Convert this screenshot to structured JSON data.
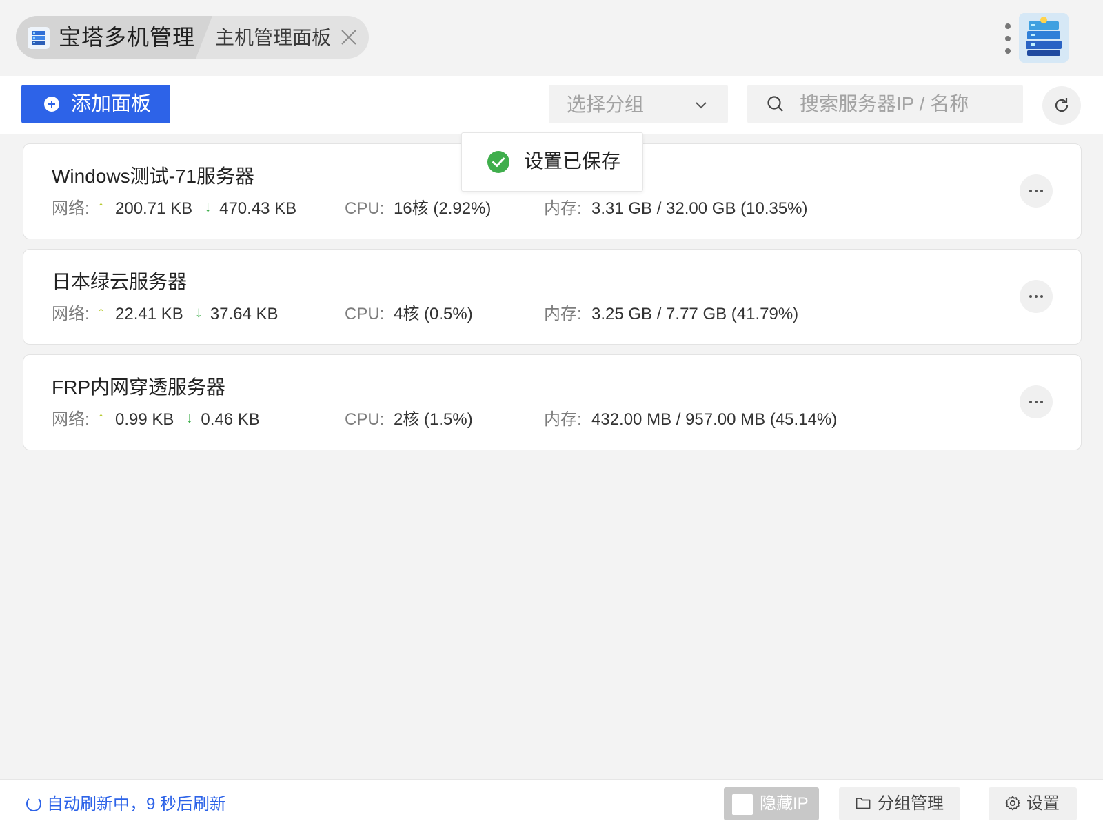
{
  "tabs": {
    "active": {
      "label": "宝塔多机管理",
      "icon": "bt-server-stack-icon"
    },
    "inactive": {
      "label": "主机管理面板",
      "close_icon": "close-icon"
    }
  },
  "toolbar": {
    "add_label": "添加面板",
    "group_select_placeholder": "选择分组",
    "search_placeholder": "搜索服务器IP / 名称"
  },
  "toast": {
    "text": "设置已保存",
    "icon": "check-circle-icon",
    "color": "#3fae4c"
  },
  "labels": {
    "network": "网络:",
    "cpu": "CPU:",
    "memory": "内存:",
    "up_arrow": "↑",
    "down_arrow": "↓"
  },
  "servers": [
    {
      "name": "Windows测试-71服务器",
      "up": "200.71 KB",
      "down": "470.43 KB",
      "cpu": "16核 (2.92%)",
      "memory": "3.31 GB / 32.00 GB (10.35%)"
    },
    {
      "name": "日本绿云服务器",
      "up": "22.41 KB",
      "down": "37.64 KB",
      "cpu": "4核 (0.5%)",
      "memory": "3.25 GB / 7.77 GB (41.79%)"
    },
    {
      "name": "FRP内网穿透服务器",
      "up": "0.99 KB",
      "down": "0.46 KB",
      "cpu": "2核 (1.5%)",
      "memory": "432.00 MB / 957.00 MB (45.14%)"
    }
  ],
  "footer": {
    "status": "自动刷新中，9 秒后刷新",
    "hide_ip_label": "隐藏IP",
    "group_manage_label": "分组管理",
    "settings_label": "设置"
  },
  "colors": {
    "accent": "#2d63e8",
    "upload_arrow": "#b5c92c",
    "download_arrow": "#3fae4c",
    "success": "#3fae4c"
  }
}
